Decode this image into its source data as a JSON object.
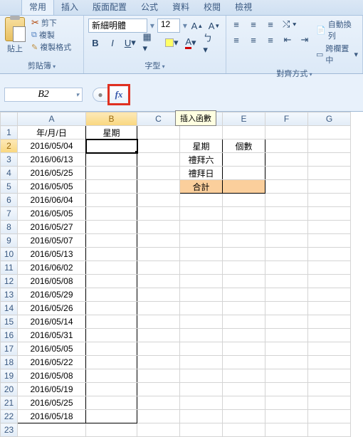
{
  "tabs": [
    "常用",
    "插入",
    "版面配置",
    "公式",
    "資料",
    "校閱",
    "檢視"
  ],
  "active_tab": 0,
  "clipboard": {
    "paste": "貼上",
    "cut": "剪下",
    "copy": "複製",
    "format_painter": "複製格式",
    "group": "剪貼簿"
  },
  "font": {
    "name": "新細明體",
    "size": "12",
    "group": "字型"
  },
  "align": {
    "wrap": "自動換列",
    "merge": "跨欄置中",
    "group": "對齊方式"
  },
  "namebox": "B2",
  "fx_label": "fx",
  "fx_tooltip": "插入函數",
  "columns": [
    "A",
    "B",
    "C",
    "D",
    "E",
    "F",
    "G"
  ],
  "rows": 23,
  "headers": {
    "A1": "年/月/日",
    "B1": "星期",
    "D2": "星期",
    "E2": "個數",
    "D3": "禮拜六",
    "D4": "禮拜日",
    "D5": "合計"
  },
  "dates": [
    "2016/05/04",
    "2016/06/13",
    "2016/05/25",
    "2016/05/05",
    "2016/06/04",
    "2016/05/05",
    "2016/05/27",
    "2016/05/07",
    "2016/05/13",
    "2016/06/02",
    "2016/05/08",
    "2016/05/29",
    "2016/05/26",
    "2016/05/14",
    "2016/05/31",
    "2016/05/05",
    "2016/05/22",
    "2016/05/08",
    "2016/05/19",
    "2016/05/25",
    "2016/05/18"
  ],
  "active_cell": "B2"
}
